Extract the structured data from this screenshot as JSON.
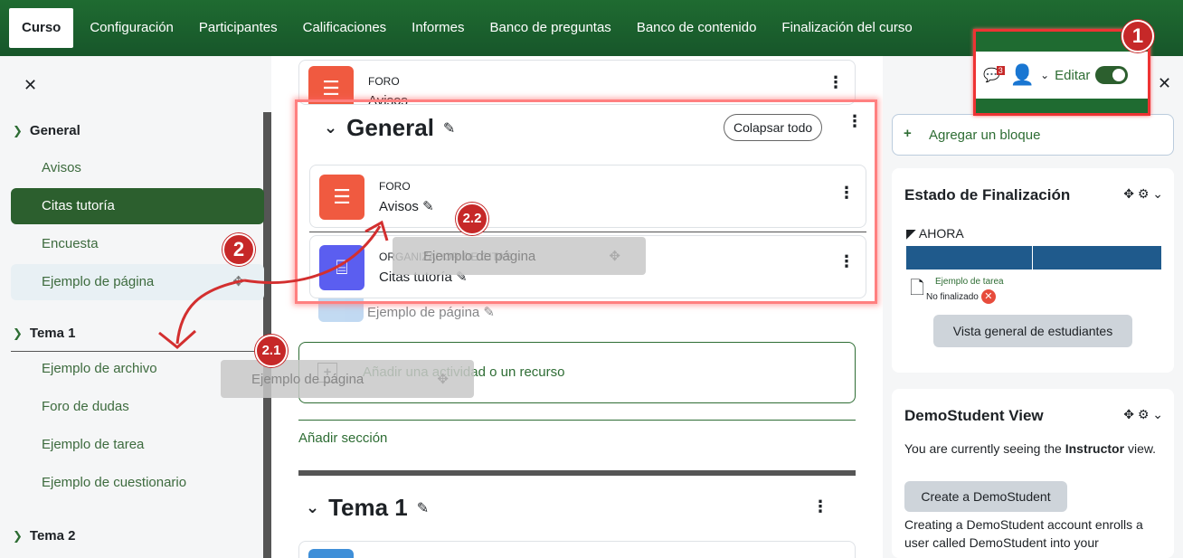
{
  "nav": {
    "tabs": [
      "Curso",
      "Configuración",
      "Participantes",
      "Calificaciones",
      "Informes",
      "Banco de preguntas",
      "Banco de contenido",
      "Finalización del curso"
    ]
  },
  "left_drawer": {
    "sections": [
      {
        "title": "General",
        "items": [
          "Avisos",
          "Citas tutoría",
          "Encuesta",
          "Ejemplo de página"
        ]
      },
      {
        "title": "Tema 1",
        "items": [
          "Ejemplo de archivo",
          "Foro de dudas",
          "Ejemplo de tarea",
          "Ejemplo de cuestionario"
        ]
      },
      {
        "title": "Tema 2",
        "items": []
      }
    ]
  },
  "main": {
    "top_card": {
      "type": "FORO",
      "name": "Avisos"
    },
    "general_title": "General",
    "collapse_label": "Colapsar todo",
    "activities": [
      {
        "type": "FORO",
        "name": "Avisos"
      },
      {
        "type": "ORGANIZADOR DE CITAS",
        "name": "Citas tutoría"
      }
    ],
    "faded_item": "Ejemplo de página",
    "add_activity": "Añadir una actividad o un recurso",
    "add_section": "Añadir sección",
    "tema1_title": "Tema 1"
  },
  "ghosts": {
    "left": "Ejemplo de página",
    "main": "Ejemplo de página"
  },
  "user_bar": {
    "notif_count": "3",
    "edit_label": "Editar"
  },
  "right_drawer": {
    "add_block": "Agregar un bloque",
    "completion": {
      "title": "Estado de Finalización",
      "now": "AHORA",
      "task_name": "Ejemplo de tarea",
      "task_status": "No finalizado",
      "overview_btn": "Vista general de estudiantes"
    },
    "demo": {
      "title": "DemoStudent View",
      "text_pre": "You are currently seeing the ",
      "text_bold": "Instructor",
      "text_post": " view.",
      "create_btn": "Create a DemoStudent",
      "desc": "Creating a DemoStudent account enrolls a user called DemoStudent into your"
    }
  },
  "annotations": {
    "b1": "1",
    "b2": "2",
    "b21": "2.1",
    "b22": "2.2"
  },
  "colors": {
    "nav_green": "#1f6b31",
    "accent_green": "#2c5f2e",
    "forum": "#f05a40",
    "scheduler": "#5b5ef0",
    "annotation_red": "#c62828"
  }
}
